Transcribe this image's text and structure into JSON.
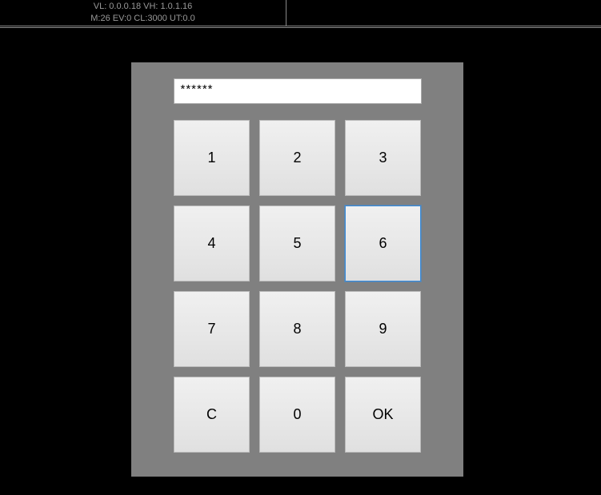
{
  "header": {
    "line1": "VL: 0.0.0.18 VH: 1.0.1.16",
    "line2": "M:26 EV:0 CL:3000 UT:0.0"
  },
  "keypad": {
    "display_value": "******",
    "keys": [
      {
        "label": "1",
        "selected": false
      },
      {
        "label": "2",
        "selected": false
      },
      {
        "label": "3",
        "selected": false
      },
      {
        "label": "4",
        "selected": false
      },
      {
        "label": "5",
        "selected": false
      },
      {
        "label": "6",
        "selected": true
      },
      {
        "label": "7",
        "selected": false
      },
      {
        "label": "8",
        "selected": false
      },
      {
        "label": "9",
        "selected": false
      },
      {
        "label": "C",
        "selected": false
      },
      {
        "label": "0",
        "selected": false
      },
      {
        "label": "OK",
        "selected": false
      }
    ]
  }
}
